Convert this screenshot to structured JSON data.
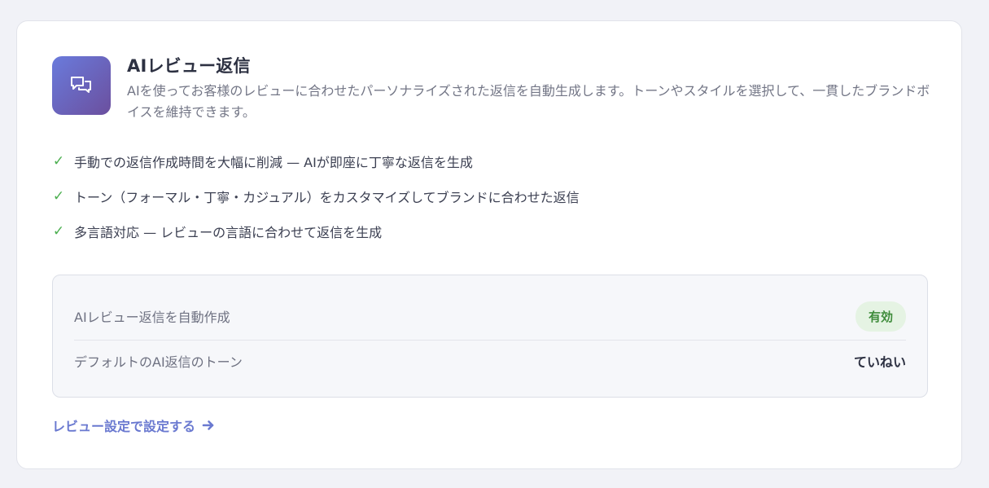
{
  "feature": {
    "icon": "chat-bubbles-icon",
    "title": "AIレビュー返信",
    "description": "AIを使ってお客様のレビューに合わせたパーソナライズされた返信を自動生成します。トーンやスタイルを選択して、一貫したブランドボイスを維持できます。"
  },
  "benefits": [
    {
      "icon": "check-icon",
      "text": "手動での返信作成時間を大幅に削減 — AIが即座に丁寧な返信を生成"
    },
    {
      "icon": "check-icon",
      "text": "トーン（フォーマル・丁寧・カジュアル）をカスタマイズしてブランドに合わせた返信"
    },
    {
      "icon": "check-icon",
      "text": "多言語対応 — レビューの言語に合わせて返信を生成"
    }
  ],
  "settings": {
    "auto_reply": {
      "label": "AIレビュー返信を自動作成",
      "value": "有効"
    },
    "default_tone": {
      "label": "デフォルトのAI返信のトーン",
      "value": "ていねい"
    }
  },
  "link": {
    "label": "レビュー設定で設定する",
    "icon": "arrow-right-icon"
  },
  "colors": {
    "accent": "#6a79d0",
    "icon_gradient_start": "#6a7bdc",
    "icon_gradient_end": "#6b4f9e",
    "check": "#4caf50",
    "badge_bg": "#e5f3e3",
    "badge_text": "#3f8c3b"
  }
}
